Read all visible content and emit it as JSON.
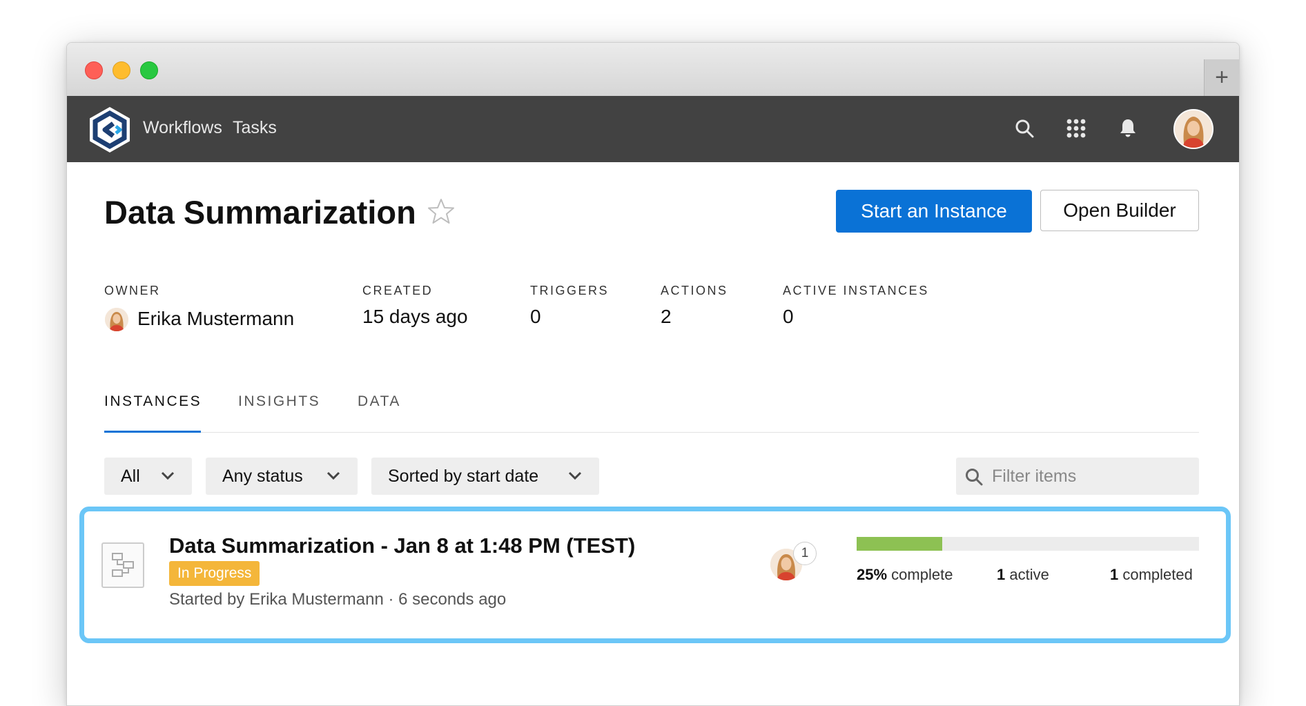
{
  "navbar": {
    "links": [
      "Workflows",
      "Tasks"
    ],
    "icons": [
      "search-icon",
      "apps-grid-icon",
      "bell-icon",
      "user-avatar"
    ]
  },
  "workflow": {
    "title": "Data Summarization",
    "primary_button": "Start an Instance",
    "secondary_button": "Open Builder",
    "meta": {
      "owner_label": "OWNER",
      "owner_value": "Erika Mustermann",
      "created_label": "CREATED",
      "created_value": "15 days ago",
      "triggers_label": "TRIGGERS",
      "triggers_value": "0",
      "actions_label": "ACTIONS",
      "actions_value": "2",
      "active_label": "ACTIVE INSTANCES",
      "active_value": "0"
    }
  },
  "tabs": [
    "INSTANCES",
    "INSIGHTS",
    "DATA"
  ],
  "active_tab": "INSTANCES",
  "filters": {
    "scope": "All",
    "status": "Any status",
    "sort": "Sorted by start date",
    "search_placeholder": "Filter items"
  },
  "instance": {
    "title": "Data Summarization - Jan 8 at 1:48 PM (TEST)",
    "status": "In Progress",
    "started": "Started by Erika Mustermann · 6 seconds ago",
    "assignee_count": "1",
    "progress_fraction": 0.25,
    "complete_pct": "25%",
    "complete_label": "complete",
    "active_count": "1",
    "active_label": "active",
    "completed_count": "1",
    "completed_label": "completed"
  },
  "colors": {
    "primary": "#0a72d6",
    "navbar": "#424242",
    "badge": "#f4b63a",
    "progress": "#8dc153",
    "highlight": "#6bc6f7"
  }
}
